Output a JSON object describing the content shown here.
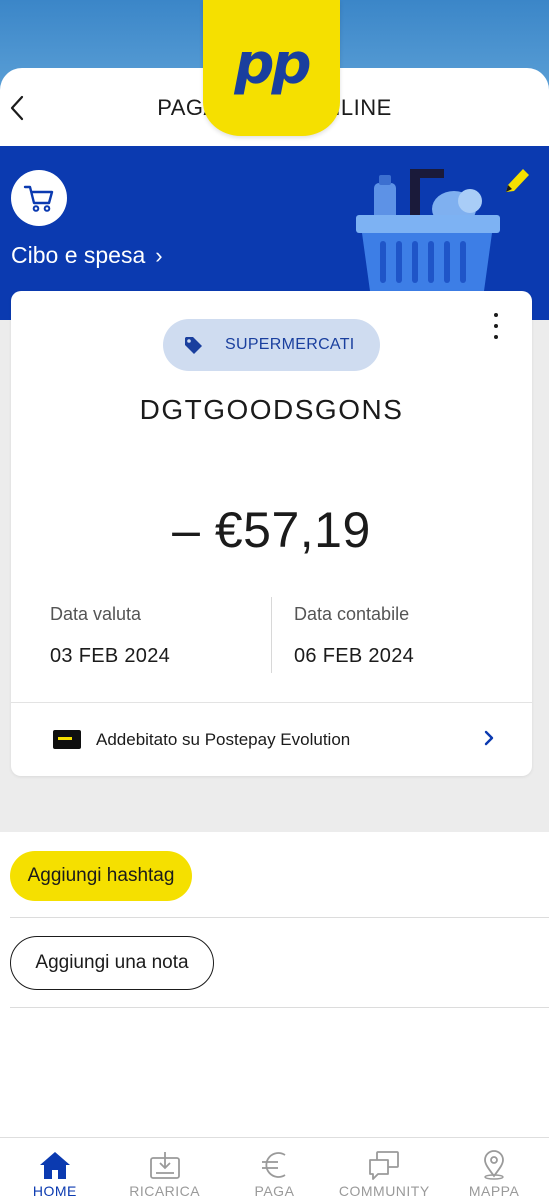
{
  "header": {
    "title": "PAGAMENTO ONLINE",
    "logo_text": "pp"
  },
  "category": {
    "label": "Cibo e spesa",
    "chevron": "›",
    "icon": "cart-icon"
  },
  "transaction": {
    "tag": "SUPERMERCATI",
    "merchant": "DGTGOODSGONS",
    "amount": "– €57,19",
    "value_date_label": "Data valuta",
    "value_date": "03 FEB 2024",
    "booking_date_label": "Data contabile",
    "booking_date": "06 FEB 2024",
    "debited_on": "Addebitato su Postepay Evolution"
  },
  "actions": {
    "hashtag": "Aggiungi hashtag",
    "note": "Aggiungi una nota"
  },
  "nav": {
    "items": [
      {
        "label": "HOME",
        "icon": "home-icon",
        "active": true
      },
      {
        "label": "RICARICA",
        "icon": "recharge-icon",
        "active": false
      },
      {
        "label": "PAGA",
        "icon": "euro-icon",
        "active": false
      },
      {
        "label": "COMMUNITY",
        "icon": "community-icon",
        "active": false
      },
      {
        "label": "MAPPA",
        "icon": "map-pin-icon",
        "active": false
      }
    ]
  },
  "colors": {
    "brand_blue": "#0b3ab0",
    "brand_yellow": "#f5e000",
    "tag_bg": "#cfdcf0"
  }
}
